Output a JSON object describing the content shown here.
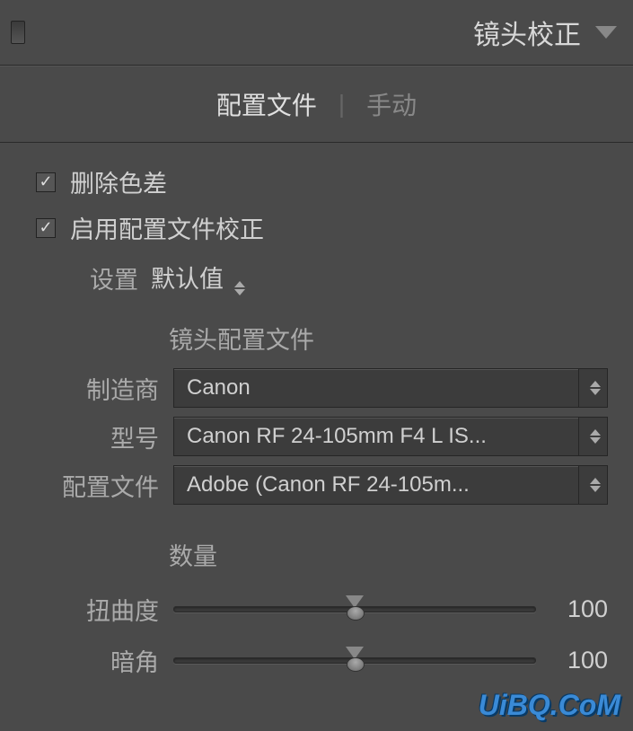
{
  "header": {
    "title": "镜头校正"
  },
  "tabs": {
    "profile": "配置文件",
    "manual": "手动"
  },
  "checkboxes": {
    "remove_ca": "删除色差",
    "enable_profile": "启用配置文件校正"
  },
  "setup": {
    "label": "设置",
    "value": "默认值"
  },
  "lens_profile": {
    "section_title": "镜头配置文件",
    "make_label": "制造商",
    "make_value": "Canon",
    "model_label": "型号",
    "model_value": "Canon RF 24-105mm F4 L IS...",
    "profile_label": "配置文件",
    "profile_value": "Adobe (Canon RF 24-105m..."
  },
  "amount": {
    "section_title": "数量",
    "distortion_label": "扭曲度",
    "distortion_value": "100",
    "vignette_label": "暗角",
    "vignette_value": "100"
  },
  "watermark": "UiBQ.CoM"
}
